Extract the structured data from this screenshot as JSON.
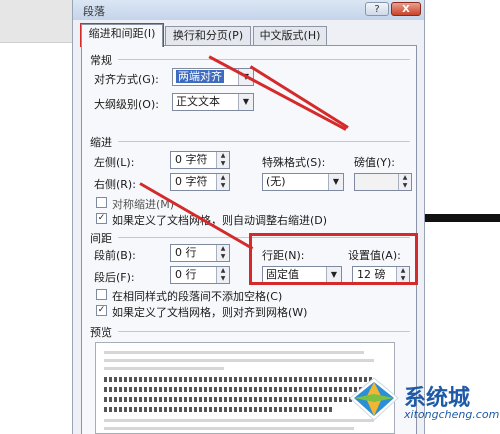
{
  "dialog": {
    "title": "段落",
    "help_label": "?",
    "close_label": "X",
    "tabs": [
      {
        "label": "缩进和间距(I)",
        "active": true
      },
      {
        "label": "换行和分页(P)",
        "active": false
      },
      {
        "label": "中文版式(H)",
        "active": false
      }
    ]
  },
  "general": {
    "heading": "常规",
    "alignment_label": "对齐方式(G):",
    "alignment_value": "两端对齐",
    "outline_label": "大纲级别(O):",
    "outline_value": "正文文本"
  },
  "indent": {
    "heading": "缩进",
    "left_label": "左侧(L):",
    "left_value": "0 字符",
    "right_label": "右侧(R):",
    "right_value": "0 字符",
    "special_label": "特殊格式(S):",
    "special_value": "(无)",
    "by_label": "磅值(Y):",
    "by_value": "",
    "mirror_label": "对称缩进(M)",
    "mirror_checked": false,
    "auto_adjust_label": "如果定义了文档网格，则自动调整右缩进(D)",
    "auto_adjust_checked": true
  },
  "spacing": {
    "heading": "间距",
    "before_label": "段前(B):",
    "before_value": "0 行",
    "after_label": "段后(F):",
    "after_value": "0 行",
    "line_spacing_label": "行距(N):",
    "line_spacing_value": "固定值",
    "at_label": "设置值(A):",
    "at_value": "12 磅",
    "no_space_label": "在相同样式的段落间不添加空格(C)",
    "no_space_checked": false,
    "snap_grid_label": "如果定义了文档网格，则对齐到网格(W)",
    "snap_grid_checked": true
  },
  "preview": {
    "heading": "预览"
  },
  "watermark": {
    "title": "系统城",
    "url": "xitongcheng.com"
  },
  "colors": {
    "annotation_red": "#d42a2a",
    "selection_blue": "#3e6bbf",
    "brand_blue": "#1e5aa8"
  }
}
